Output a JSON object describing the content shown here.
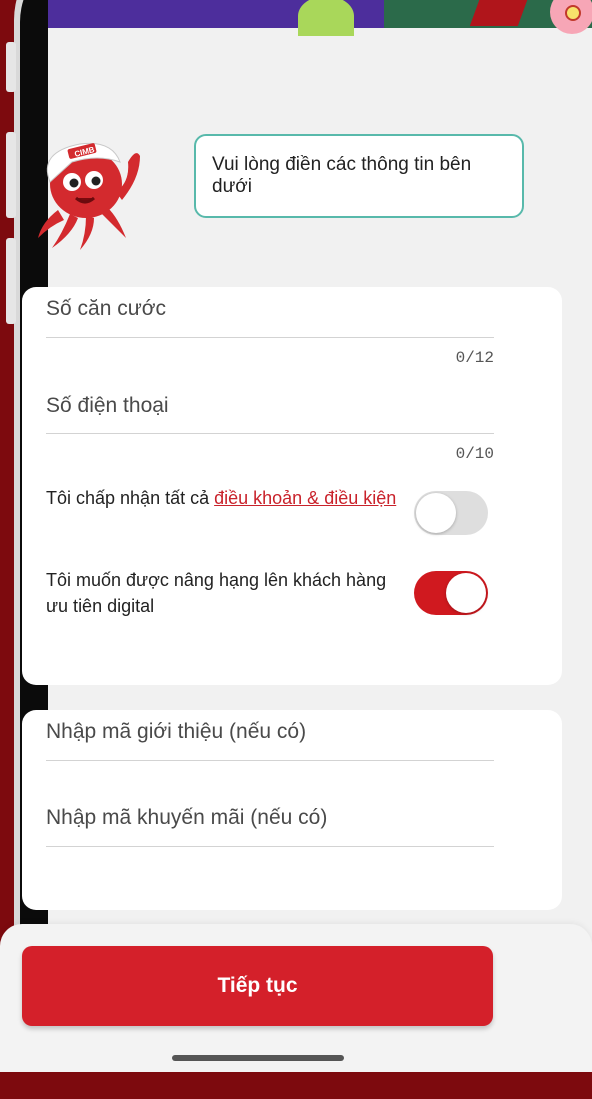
{
  "assistant": {
    "message": "Vui lòng điền các thông tin bên dưới",
    "mascot_icon": "octopus-mascot-icon",
    "mascot_cap_text": "CIMB"
  },
  "form": {
    "id_number": {
      "placeholder": "Số căn cước",
      "counter": "0/12"
    },
    "phone": {
      "placeholder": "Số điện thoại",
      "counter": "0/10"
    },
    "terms": {
      "prefix": "Tôi chấp nhận tất cả ",
      "link": "điều khoản & điều kiện",
      "checked": false
    },
    "priority": {
      "label": "Tôi muốn được nâng hạng lên khách hàng ưu tiên digital",
      "checked": true
    }
  },
  "codes": {
    "referral_placeholder": "Nhập mã giới thiệu (nếu có)",
    "promo_placeholder": "Nhập mã khuyến mãi (nếu có)"
  },
  "actions": {
    "continue_label": "Tiếp tục"
  },
  "colors": {
    "brand_red": "#d4202a",
    "background": "#7d0a0e",
    "bubble_border": "#58b9ab"
  }
}
